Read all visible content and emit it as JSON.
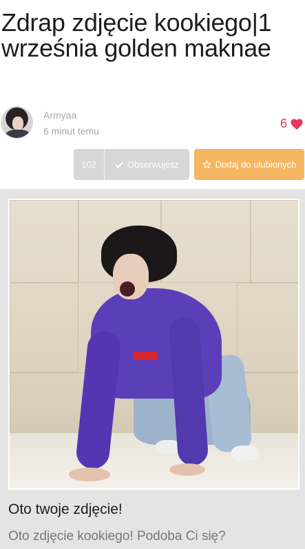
{
  "post": {
    "title": "Zdrap zdjęcie kookiego|1 września golden maknae"
  },
  "author": {
    "name": "Armyaa",
    "time": "6 minut temu",
    "avatar_icon": "user-avatar"
  },
  "likes": {
    "count": "6",
    "icon": "heart-icon",
    "color": "#e8375c"
  },
  "actions": {
    "followers_count": "102",
    "follow_label": "Obserwujesz",
    "follow_icon": "check-icon",
    "favorite_label": "Dodaj do ulubionych",
    "favorite_icon": "star-outline-icon",
    "favorite_color": "#f5b661",
    "follow_color": "#d7d7d7"
  },
  "card": {
    "title": "Oto twoje zdjęcie!",
    "description": "Oto zdjęcie kookiego! Podoba Ci się?"
  }
}
